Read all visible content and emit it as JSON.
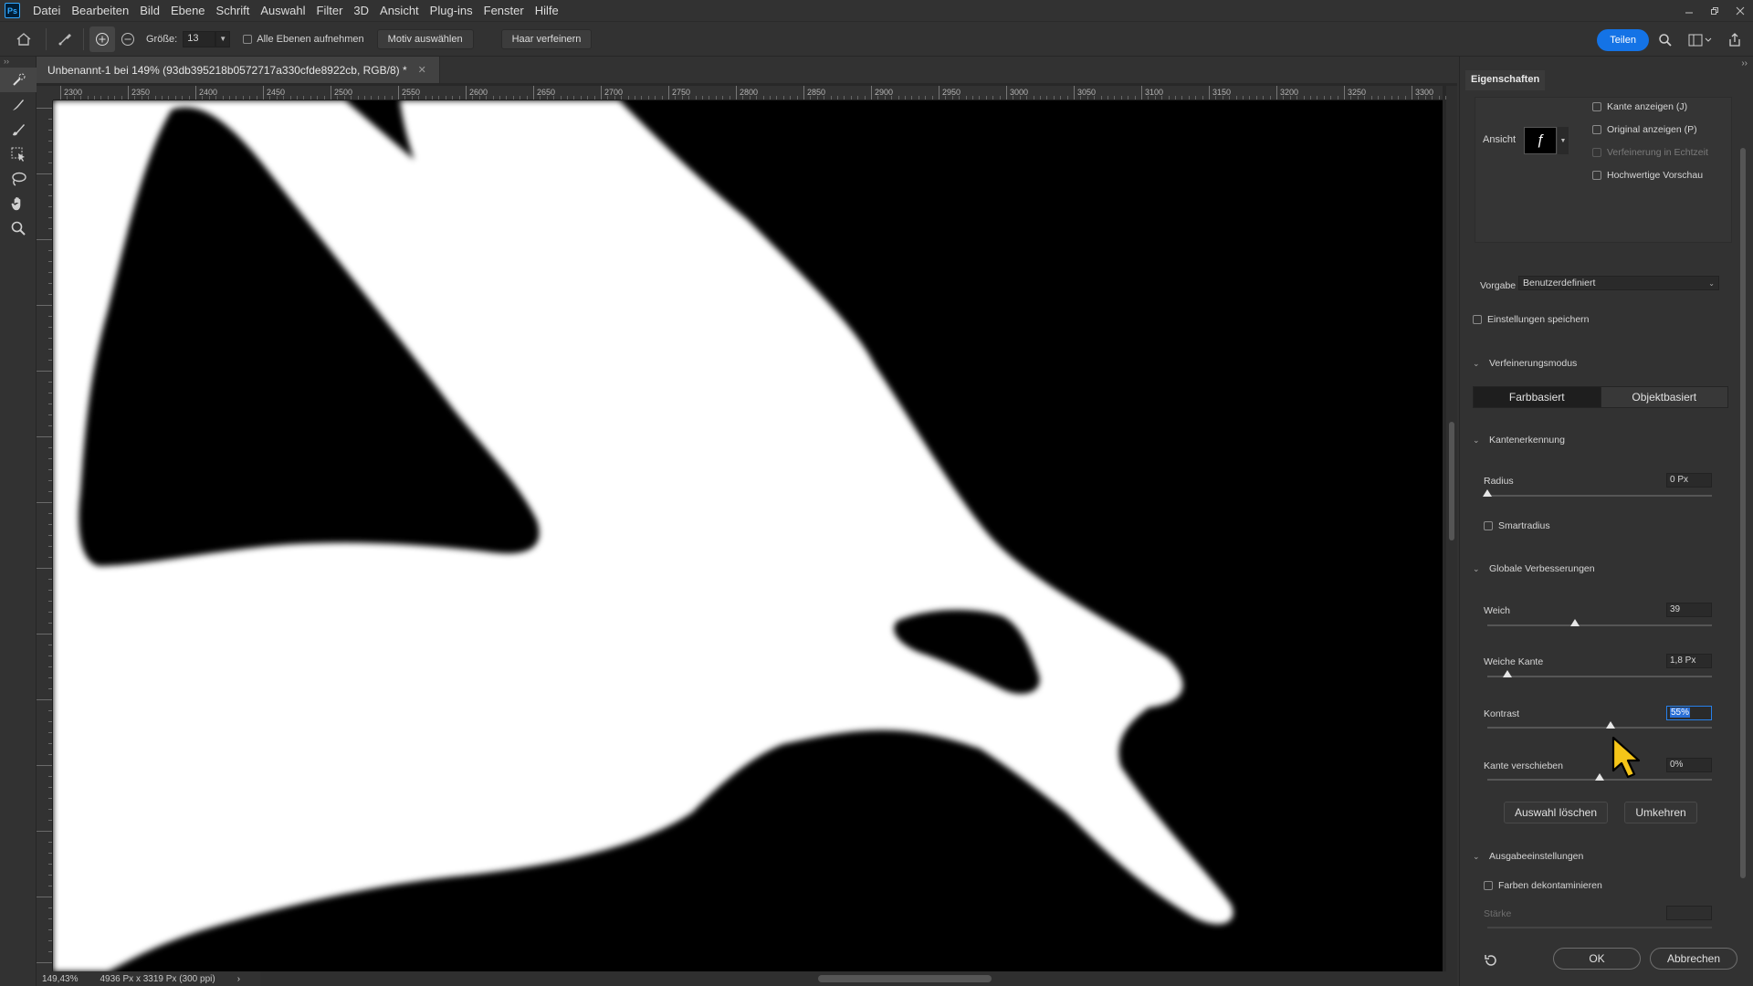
{
  "app": {
    "logo": "Ps"
  },
  "menu": [
    "Datei",
    "Bearbeiten",
    "Bild",
    "Ebene",
    "Schrift",
    "Auswahl",
    "Filter",
    "3D",
    "Ansicht",
    "Plug-ins",
    "Fenster",
    "Hilfe"
  ],
  "options": {
    "size_label": "Größe:",
    "size_value": "13",
    "sample_all_layers": "Alle Ebenen aufnehmen",
    "select_subject": "Motiv auswählen",
    "refine_hair": "Haar verfeinern",
    "share": "Teilen"
  },
  "document": {
    "tab_title": "Unbenannt-1 bei 149% (93db395218b0572717a330cfde8922cb, RGB/8) *",
    "ruler_h_labels": [
      "2300",
      "2350",
      "2400",
      "2450",
      "2500",
      "2550",
      "2600",
      "2650",
      "2700",
      "2750",
      "2800",
      "2850",
      "2900",
      "2950",
      "3000",
      "3050",
      "3100",
      "3150",
      "3200",
      "3250",
      "3300"
    ],
    "zoom": "149,43%",
    "dimensions": "4936 Px x 3319 Px (300 ppi)"
  },
  "panel": {
    "tab": "Eigenschaften",
    "view": {
      "label": "Ansicht",
      "show_edge": "Kante anzeigen (J)",
      "show_original": "Original anzeigen (P)",
      "realtime_refine": "Verfeinerung in Echtzeit",
      "high_quality_preview": "Hochwertige Vorschau"
    },
    "preset": {
      "label": "Vorgabe",
      "value": "Benutzerdefiniert"
    },
    "save_settings": "Einstellungen speichern",
    "refine_mode": {
      "title": "Verfeinerungsmodus",
      "color_based": "Farbbasiert",
      "object_based": "Objektbasiert"
    },
    "edge_detection": {
      "title": "Kantenerkennung",
      "radius_label": "Radius",
      "radius_value": "0 Px",
      "radius_pos": 0.0,
      "smart_radius": "Smartradius"
    },
    "global": {
      "title": "Globale Verbesserungen",
      "smooth_label": "Weich",
      "smooth_value": "39",
      "smooth_pos": 0.39,
      "feather_label": "Weiche Kante",
      "feather_value": "1,8 Px",
      "feather_pos": 0.09,
      "contrast_label": "Kontrast",
      "contrast_value": "55%",
      "contrast_pos": 0.55,
      "shift_label": "Kante verschieben",
      "shift_value": "0%",
      "shift_pos": 0.5,
      "clear_selection": "Auswahl löschen",
      "invert": "Umkehren"
    },
    "output": {
      "title": "Ausgabeeinstellungen",
      "decontaminate": "Farben dekontaminieren",
      "amount_label": "Stärke"
    },
    "ok": "OK",
    "cancel": "Abbrechen"
  }
}
